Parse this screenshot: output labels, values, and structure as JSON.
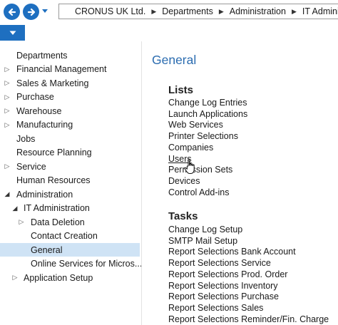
{
  "breadcrumb": {
    "items": [
      "CRONUS UK Ltd.",
      "Departments",
      "Administration",
      "IT Adminis"
    ]
  },
  "colors": {
    "accent": "#1e6fc0",
    "title": "#2b6cb0",
    "selected_bg": "#cfe3f5"
  },
  "sidebar": {
    "items": [
      {
        "label": "Departments",
        "expander": "none"
      },
      {
        "label": "Financial Management",
        "expander": "collapsed"
      },
      {
        "label": "Sales & Marketing",
        "expander": "collapsed"
      },
      {
        "label": "Purchase",
        "expander": "collapsed"
      },
      {
        "label": "Warehouse",
        "expander": "collapsed"
      },
      {
        "label": "Manufacturing",
        "expander": "collapsed"
      },
      {
        "label": "Jobs",
        "expander": "none"
      },
      {
        "label": "Resource Planning",
        "expander": "none"
      },
      {
        "label": "Service",
        "expander": "collapsed"
      },
      {
        "label": "Human Resources",
        "expander": "none"
      },
      {
        "label": "Administration",
        "expander": "expanded"
      },
      {
        "label": "IT Administration",
        "expander": "expanded"
      },
      {
        "label": "Data Deletion",
        "expander": "collapsed"
      },
      {
        "label": "Contact Creation",
        "expander": "none"
      },
      {
        "label": "General",
        "expander": "none",
        "selected": true
      },
      {
        "label": "Online Services for Micros...",
        "expander": "none"
      },
      {
        "label": "Application Setup",
        "expander": "collapsed"
      }
    ]
  },
  "main": {
    "title": "General",
    "lists_heading": "Lists",
    "lists": [
      "Change Log Entries",
      "Launch Applications",
      "Web Services",
      "Printer Selections",
      "Companies",
      "Users",
      "Permission Sets",
      "Devices",
      "Control Add-ins"
    ],
    "tasks_heading": "Tasks",
    "tasks": [
      "Change Log Setup",
      "SMTP Mail Setup",
      "Report Selections Bank Account",
      "Report Selections Service",
      "Report Selections Prod. Order",
      "Report Selections Inventory",
      "Report Selections Purchase",
      "Report Selections Sales",
      "Report Selections Reminder/Fin. Charge"
    ]
  }
}
